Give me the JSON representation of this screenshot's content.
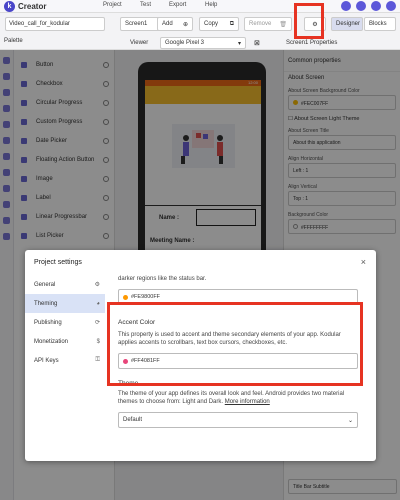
{
  "app": {
    "logo_letter": "k",
    "brand": "Creator",
    "menu": [
      "Project",
      "Test",
      "Export",
      "Help"
    ]
  },
  "toolbar": {
    "project_name": "Video_call_for_kodular",
    "screen": "Screen1",
    "add": "Add",
    "copy": "Copy",
    "remove": "Remove",
    "designer": "Designer",
    "blocks": "Blocks"
  },
  "palette": {
    "title": "Palette",
    "items": [
      "Button",
      "Checkbox",
      "Circular Progress",
      "Custom Progress",
      "Date Picker",
      "Floating Action Button",
      "Image",
      "Label",
      "Linear Progressbar",
      "List Picker"
    ]
  },
  "viewer": {
    "label": "Viewer",
    "device": "Google Pixel 3",
    "status_time": "12:00",
    "name_label": "Name :",
    "meeting_label": "Meeting Name :"
  },
  "properties": {
    "title": "Screen1 Properties",
    "section": "Common properties",
    "about_screen": "About Screen",
    "bg_color_label": "About Screen Background Color",
    "bg_color_value": "#FEC007FF",
    "light_theme": "About Screen Light Theme",
    "title_label": "About Screen Title",
    "title_value": "About this application",
    "align_h_label": "Align Horizontal",
    "align_h_value": "Left : 1",
    "align_v_label": "Align Vertical",
    "align_v_value": "Top : 1",
    "bg_label": "Background Color",
    "bg_value": "#FFFFFFFF",
    "bottom_label": "Title Bar Subtitle"
  },
  "dialog": {
    "title": "Project settings",
    "close": "×",
    "nav": [
      {
        "label": "General",
        "icon": "settings-icon"
      },
      {
        "label": "Theming",
        "icon": "palette-icon"
      },
      {
        "label": "Publishing",
        "icon": "sync-icon"
      },
      {
        "label": "Monetization",
        "icon": "money-icon"
      },
      {
        "label": "API Keys",
        "icon": "key-icon"
      }
    ],
    "top_desc": "darker regions like the status bar.",
    "top_value": "#FE9800FF",
    "accent_title": "Accent Color",
    "accent_desc": "This property is used to accent and theme secondary elements of your app. Kodular applies accents to scrollbars, text box cursors, checkboxes, etc.",
    "accent_value": "#FF4081FF",
    "theme_title": "Theme",
    "theme_desc": "The theme of your app defines its overall look and feel. Android provides two material themes to choose from: Light and Dark.",
    "theme_link": "More information",
    "theme_value": "Default"
  },
  "colors": {
    "accent_dot": "#e8457a",
    "top_dot": "#fe9800",
    "highlight": "#e63322",
    "brand": "#4a46c9"
  }
}
